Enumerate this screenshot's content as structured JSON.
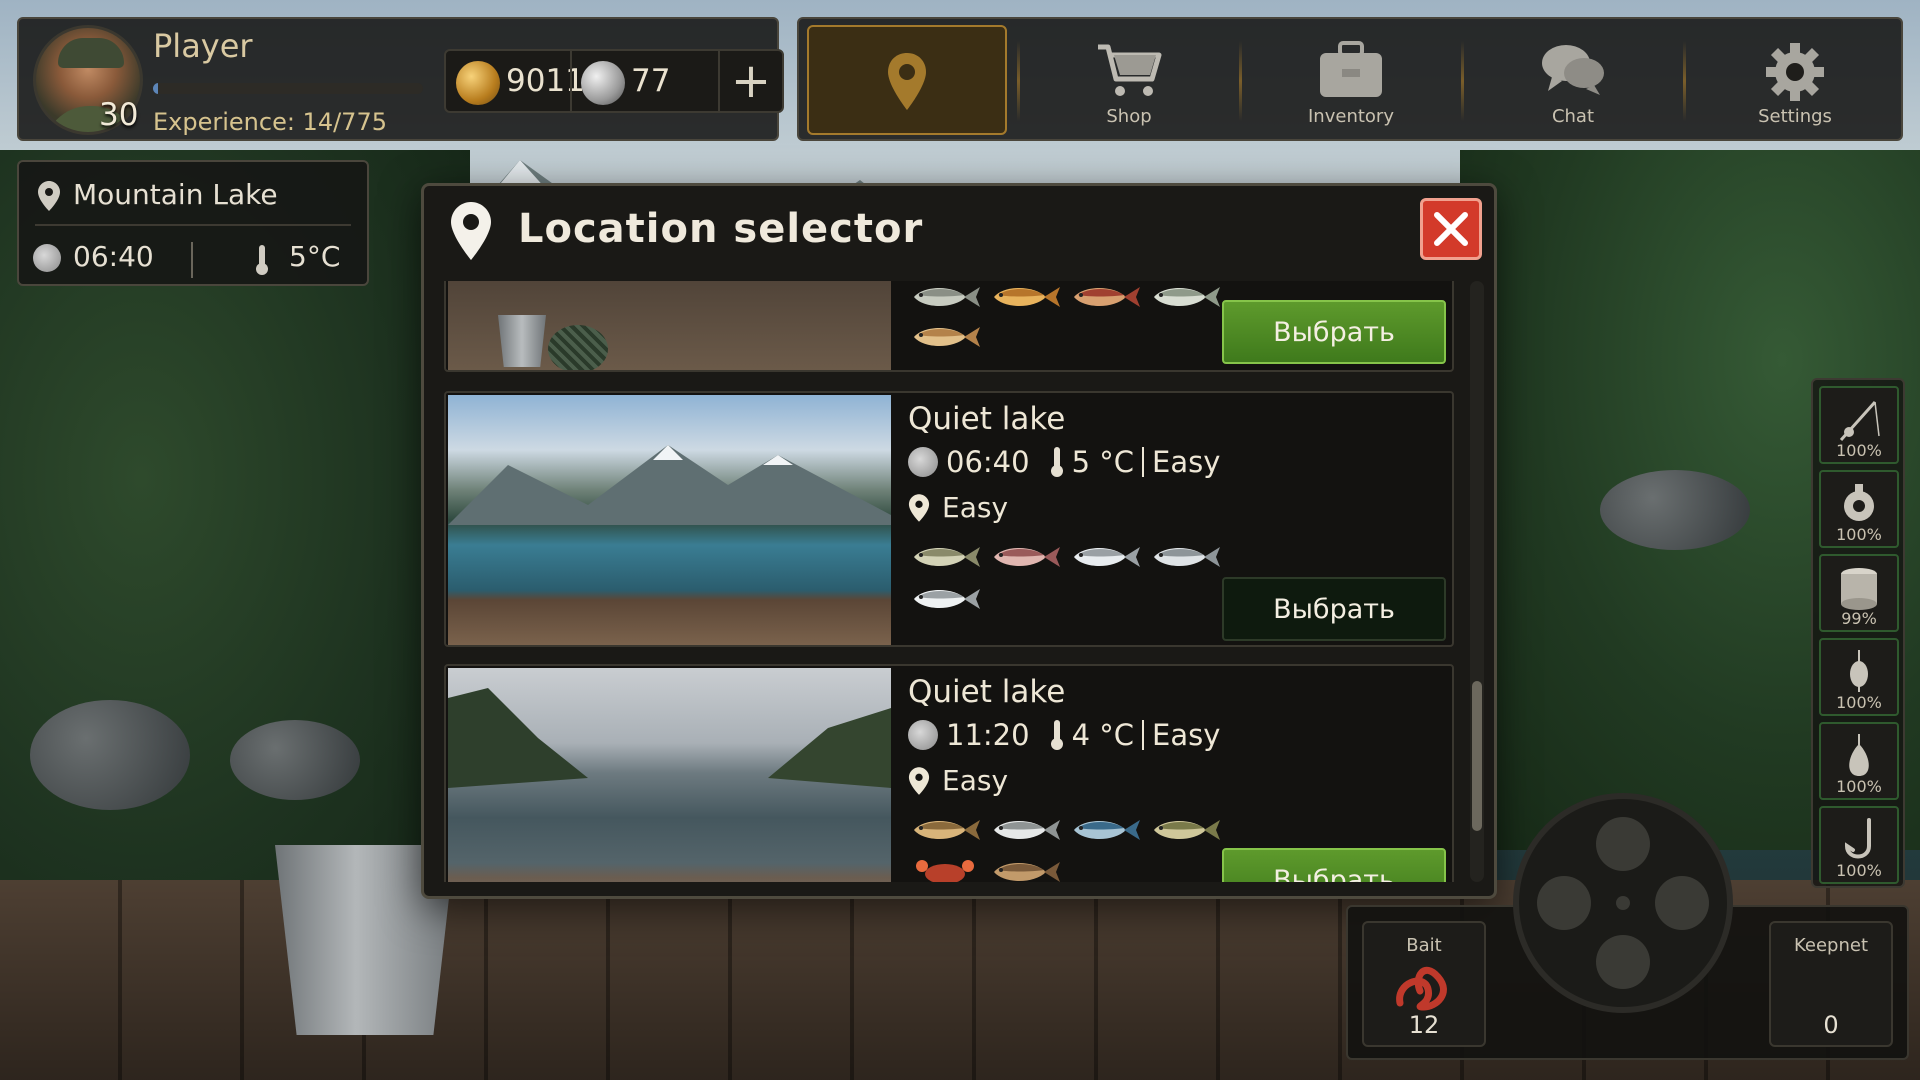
{
  "player": {
    "name": "Player",
    "level": "30",
    "experience_text": "Experience: 14/775",
    "experience_fraction": 0.018
  },
  "currency": {
    "gold": "9011",
    "silver": "77",
    "add_label": "+"
  },
  "nav": {
    "items": [
      {
        "id": "location",
        "label": "",
        "icon": "location-pin-icon",
        "active": true
      },
      {
        "id": "shop",
        "label": "Shop",
        "icon": "shopping-cart-icon"
      },
      {
        "id": "inventory",
        "label": "Inventory",
        "icon": "briefcase-icon"
      },
      {
        "id": "chat",
        "label": "Chat",
        "icon": "chat-bubbles-icon"
      },
      {
        "id": "settings",
        "label": "Settings",
        "icon": "gear-icon"
      }
    ]
  },
  "location_info": {
    "name": "Mountain Lake",
    "time": "06:40",
    "temperature": "5°C"
  },
  "modal": {
    "title": "Location selector",
    "close_icon": "close-icon",
    "cards": [
      {
        "title": "",
        "time": "",
        "temperature": "",
        "difficulty_inline": "",
        "difficulty": "",
        "fish": [
          "perch",
          "golden-carp",
          "red-fin",
          "pike",
          "salmon"
        ],
        "button": "Выбрать",
        "button_style": "green"
      },
      {
        "title": "Quiet lake",
        "time": "06:40",
        "temperature": "5 °C",
        "difficulty_inline": "Easy",
        "difficulty": "Easy",
        "fish": [
          "trout",
          "red-trout",
          "whitefish",
          "silver-fish",
          "grayling"
        ],
        "button": "Выбрать",
        "button_style": "dark"
      },
      {
        "title": "Quiet lake",
        "time": "11:20",
        "temperature": "4 °C",
        "difficulty_inline": "Easy",
        "difficulty": "Easy",
        "fish": [
          "cod",
          "pollock",
          "mackerel",
          "striped-bass",
          "crab",
          "flounder"
        ],
        "button": "Выбрать",
        "button_style": "green"
      }
    ]
  },
  "gear": [
    {
      "name": "rod-icon",
      "pct": "100%"
    },
    {
      "name": "reel-icon",
      "pct": "100%"
    },
    {
      "name": "line-spool-icon",
      "pct": "99%"
    },
    {
      "name": "float-icon",
      "pct": "100%"
    },
    {
      "name": "sinker-icon",
      "pct": "100%"
    },
    {
      "name": "hook-icon",
      "pct": "100%"
    }
  ],
  "bait": {
    "label": "Bait",
    "count": "12",
    "icon": "worm-icon"
  },
  "keepnet": {
    "label": "Keepnet",
    "count": "0"
  },
  "colors": {
    "accent_gold": "#a47a2c",
    "select_green": "#4f8a24",
    "close_red": "#d33a2a"
  }
}
